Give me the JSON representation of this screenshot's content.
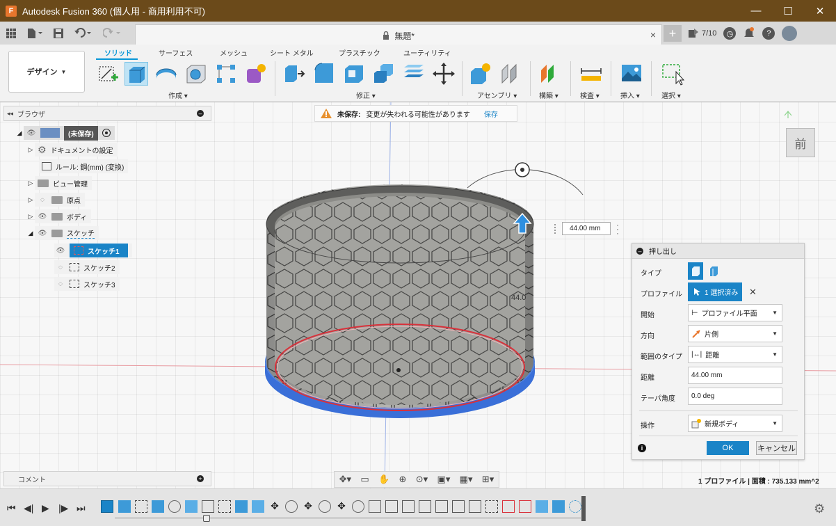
{
  "window": {
    "app_title": "Autodesk Fusion 360 (個人用 - 商用利用不可)",
    "logo_letter": "F",
    "minimize": "—",
    "maximize": "☐",
    "close": "✕"
  },
  "tabs": {
    "document_title": "無題*",
    "close": "×",
    "new_tab": "+",
    "jobs": "7/10"
  },
  "ribbon": {
    "workspace": "デザイン",
    "tabs": [
      "ソリッド",
      "サーフェス",
      "メッシュ",
      "シート メタル",
      "プラスチック",
      "ユーティリティ"
    ],
    "groups": [
      "作成",
      "修正",
      "アセンブリ",
      "構築",
      "検査",
      "挿入",
      "選択"
    ]
  },
  "browser": {
    "title": "ブラウザ",
    "root": "(未保存)",
    "items": [
      "ドキュメントの設定",
      "ルール: 鋼(mm) (変換)",
      "ビュー管理",
      "原点",
      "ボディ",
      "スケッチ"
    ],
    "sketches": [
      "スケッチ1",
      "スケッチ2",
      "スケッチ3"
    ]
  },
  "warning": {
    "label": "未保存:",
    "message": "変更が失われる可能性があります",
    "action": "保存"
  },
  "viewport": {
    "dimension_value": "44.00 mm",
    "inline_label": "44.0",
    "viewcube_label": "前"
  },
  "extrude": {
    "title": "押し出し",
    "type_label": "タイプ",
    "profile_label": "プロファイル",
    "profile_value": "1 選択済み",
    "start_label": "開始",
    "start_value": "プロファイル平面",
    "direction_label": "方向",
    "direction_value": "片側",
    "extent_label": "範囲のタイプ",
    "extent_value": "距離",
    "distance_label": "距離",
    "distance_value": "44.00 mm",
    "taper_label": "テーパ角度",
    "taper_value": "0.0 deg",
    "operation_label": "操作",
    "operation_value": "新規ボディ",
    "ok": "OK",
    "cancel": "キャンセル"
  },
  "comments": {
    "title": "コメント"
  },
  "status": {
    "text": "1 プロファイル | 面積 : 735.133 mm^2"
  },
  "colors": {
    "titlebar": "#6b4a1a",
    "accent": "#1a84c7",
    "extrude_base": "#3a6fd8",
    "profile_edge": "#d9303a"
  }
}
